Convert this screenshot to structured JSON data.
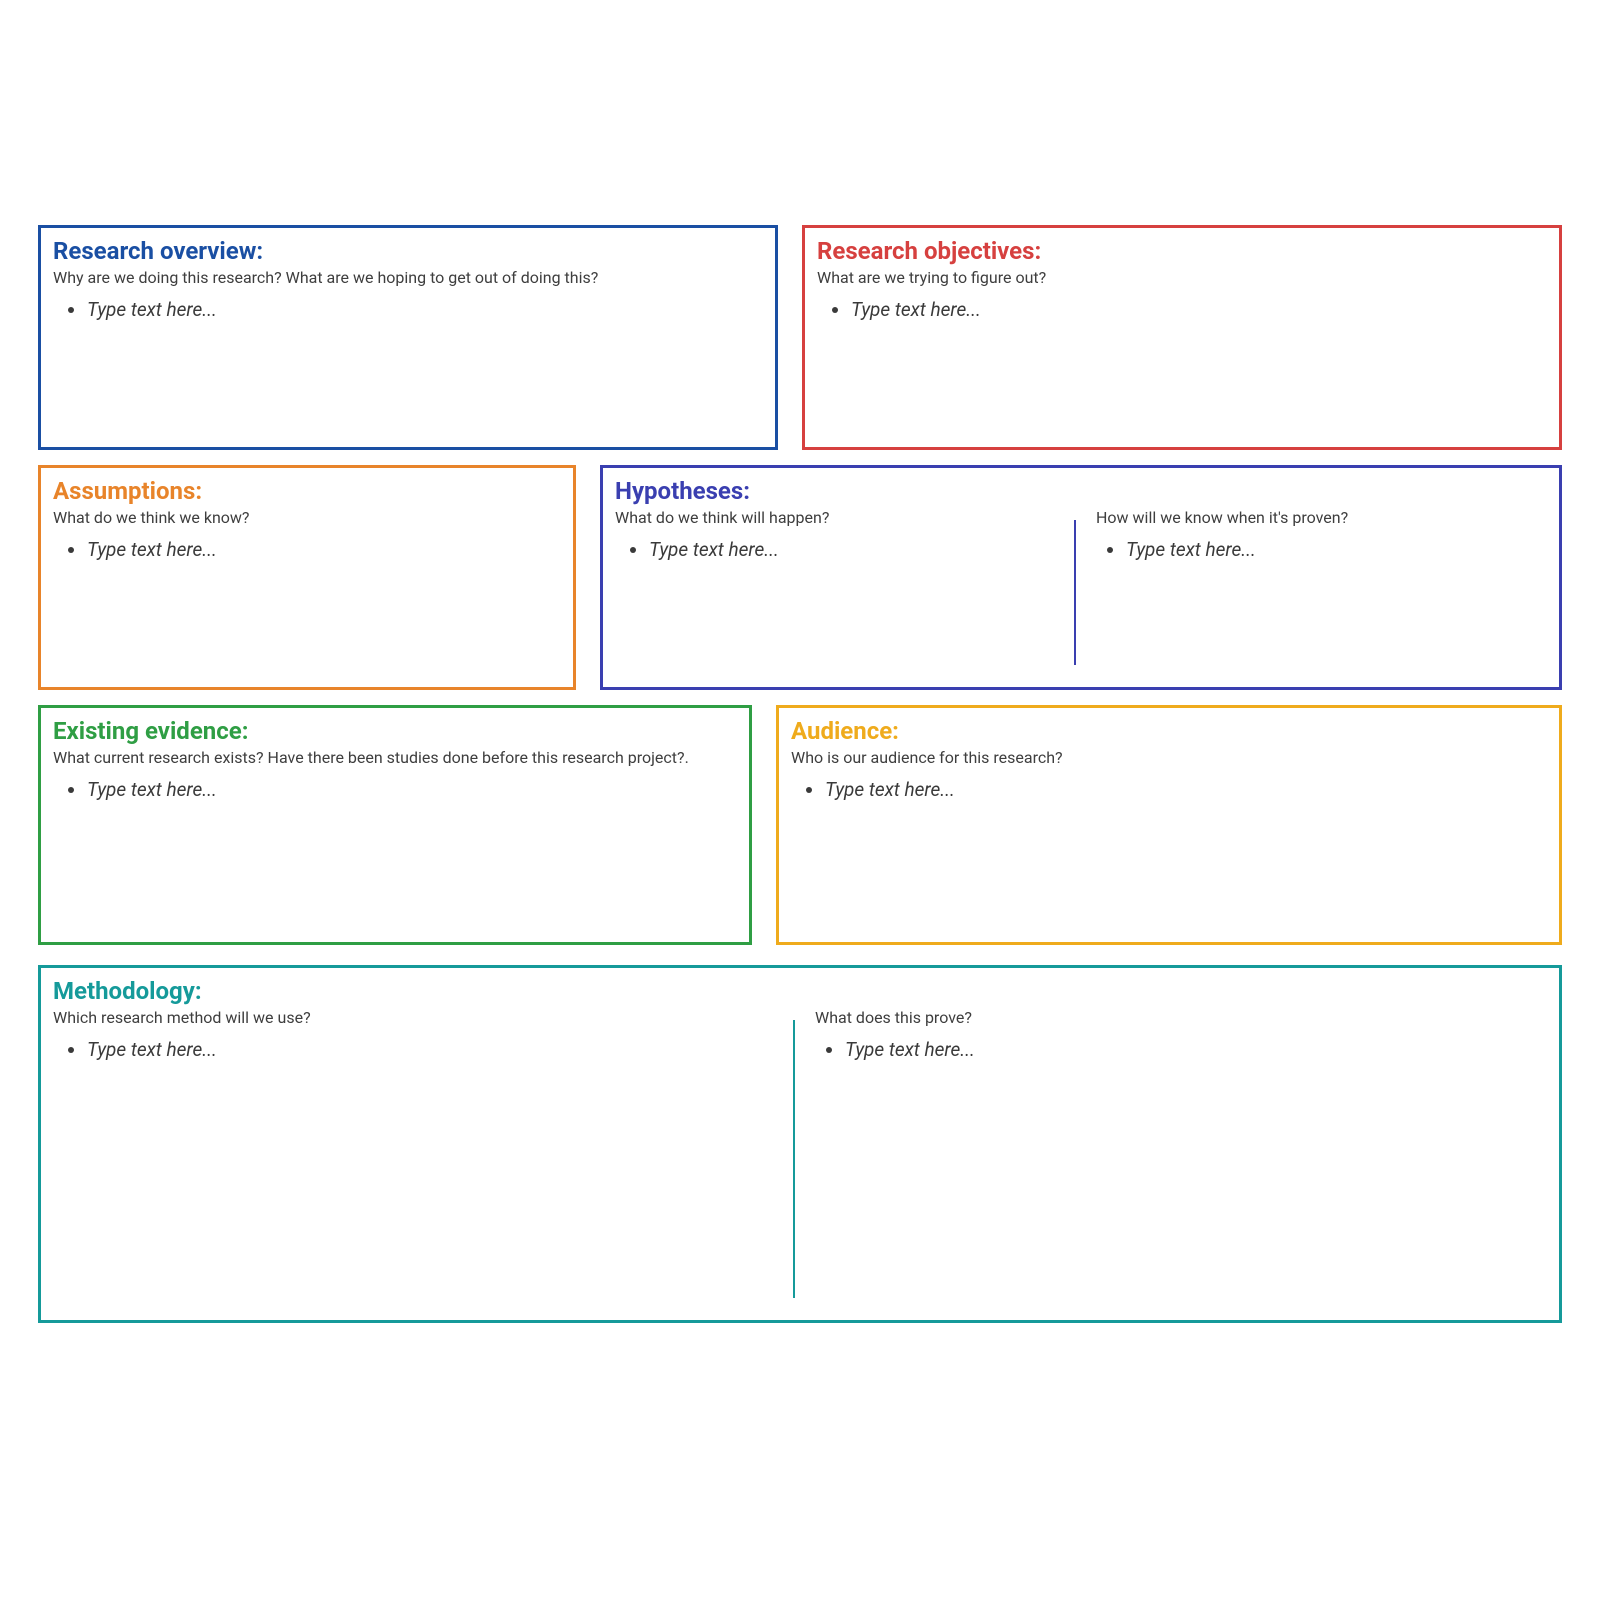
{
  "placeholder": "Type text here...",
  "sections": {
    "overview": {
      "title": "Research overview:",
      "sub": "Why are we doing this research? What are we hoping to get out of doing this?"
    },
    "objectives": {
      "title": "Research objectives:",
      "sub": "What are we trying to figure out?"
    },
    "assumptions": {
      "title": "Assumptions:",
      "sub": "What do we think we know?"
    },
    "hypotheses": {
      "title": "Hypotheses:",
      "sub_left": "What do we think will happen?",
      "sub_right": "How will we know when it's proven?"
    },
    "evidence": {
      "title": "Existing evidence:",
      "sub": "What current research exists? Have there been studies done before this research project?."
    },
    "audience": {
      "title": "Audience:",
      "sub": "Who is our audience for this research?"
    },
    "methodology": {
      "title": "Methodology:",
      "sub_left": "Which research method will we use?",
      "sub_right": "What does this prove?"
    }
  }
}
